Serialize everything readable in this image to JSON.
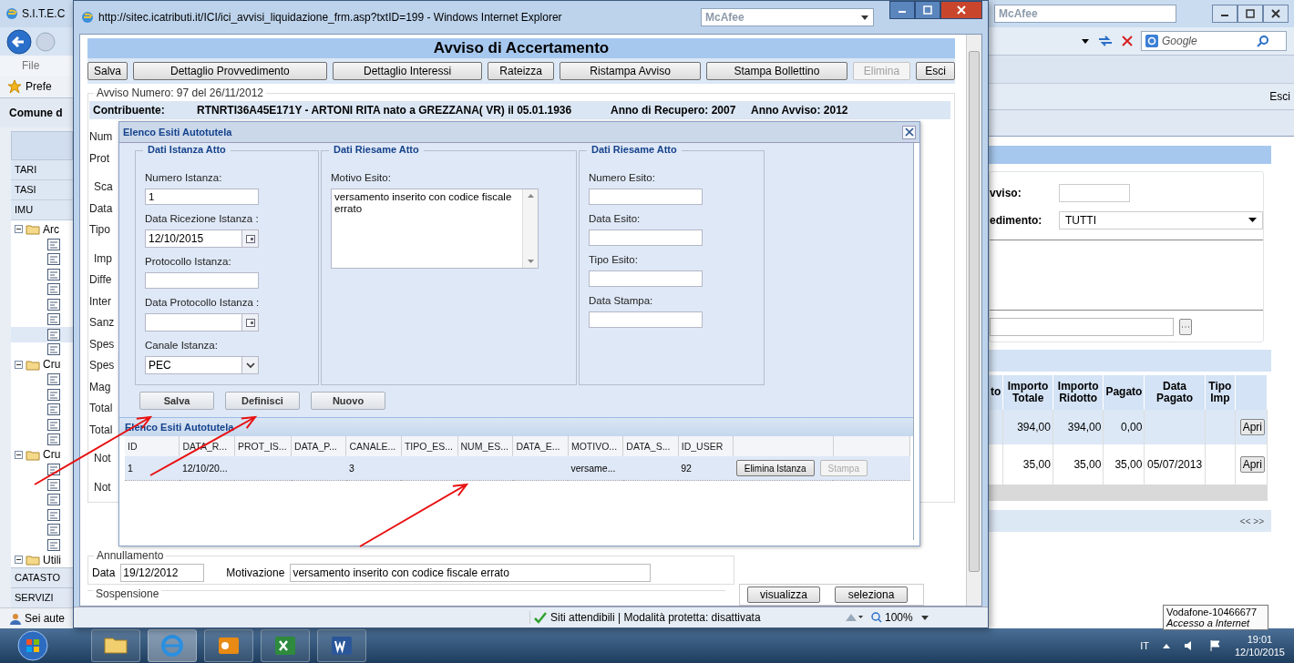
{
  "back_window": {
    "title": "S.I.T.E.C",
    "menu": [
      "File"
    ],
    "favorites": "Prefe",
    "header": "Comune d",
    "sidebar": [
      {
        "label": "TARI"
      },
      {
        "label": "TASI"
      },
      {
        "label": "IMU"
      }
    ],
    "tree": [
      {
        "label": "Arc",
        "expanded": true,
        "children": [
          {
            "kind": "leaf",
            "selected": false
          },
          {
            "kind": "leaf",
            "selected": false
          },
          {
            "kind": "leaf",
            "selected": false
          },
          {
            "kind": "leaf",
            "selected": false
          },
          {
            "kind": "leaf",
            "selected": false
          },
          {
            "kind": "leaf",
            "selected": false
          },
          {
            "kind": "leaf",
            "selected": true
          },
          {
            "kind": "leaf",
            "selected": false
          }
        ]
      },
      {
        "label": "Cru",
        "expanded": true,
        "children": [
          {
            "kind": "leaf",
            "selected": false
          },
          {
            "kind": "leaf",
            "selected": false
          },
          {
            "kind": "leaf",
            "selected": false
          },
          {
            "kind": "leaf",
            "selected": false
          },
          {
            "kind": "leaf",
            "selected": false
          }
        ]
      },
      {
        "label": "Cru",
        "expanded": true,
        "children": [
          {
            "kind": "leaf",
            "selected": false
          },
          {
            "kind": "leaf",
            "selected": false
          },
          {
            "kind": "leaf",
            "selected": false
          },
          {
            "kind": "leaf",
            "selected": false
          },
          {
            "kind": "leaf",
            "selected": false
          },
          {
            "kind": "leaf",
            "selected": false
          }
        ]
      },
      {
        "label": "Utili",
        "expanded": true
      }
    ],
    "footer_items": [
      {
        "label": "CATASTO"
      },
      {
        "label": "SERVIZI"
      }
    ],
    "status": "Sei aute",
    "addon": "McAfee",
    "search": {
      "placeholder": "Google"
    },
    "logout": "Esci",
    "form": [
      {
        "label": "vviso:",
        "kind": "text"
      },
      {
        "label": "edimento:",
        "kind": "select",
        "value": "TUTTI"
      }
    ],
    "table": {
      "columns": [
        "to",
        "Importo Totale",
        "Importo Ridotto",
        "Pagato",
        "Data Pagato",
        "Tipo Imp"
      ],
      "rows": [
        {
          "cells": [
            null,
            "394,00",
            "394,00",
            "0,00",
            null,
            null
          ],
          "action": "Apri"
        },
        {
          "cells": [
            null,
            "35,00",
            "35,00",
            "35,00",
            "05/07/2013",
            null
          ],
          "action": "Apri"
        }
      ]
    },
    "pager": "<< >>"
  },
  "front_window": {
    "title": "http://sitec.icatributi.it/ICI/ici_avvisi_liquidazione_frm.asp?txtID=199 - Windows Internet Explorer",
    "addon": "McAfee",
    "page_title": "Avviso di Accertamento",
    "toolbar": [
      {
        "label": "Salva",
        "disabled": false
      },
      {
        "label": "Dettaglio Provvedimento",
        "disabled": false
      },
      {
        "label": "Dettaglio Interessi",
        "disabled": false
      },
      {
        "label": "Rateizza",
        "disabled": false
      },
      {
        "label": "Ristampa Avviso",
        "disabled": false
      },
      {
        "label": "Stampa Bollettino",
        "disabled": false
      },
      {
        "label": "Elimina",
        "disabled": true
      },
      {
        "label": "Esci",
        "disabled": false
      }
    ],
    "avviso_legend": "Avviso Numero: 97 del 26/11/2012",
    "contribuente": {
      "label": "Contribuente:",
      "value": "RTNRTI36A45E171Y - ARTONI RITA nato a GREZZANA( VR) il 05.01.1936",
      "anno_recupero": "Anno di Recupero: 2007",
      "anno_avviso": "Anno Avviso: 2012"
    },
    "partial_labels": [
      {
        "label": "Num",
        "kind": "label"
      },
      {
        "label": "Prot",
        "kind": "label"
      },
      {
        "label": "Sca",
        "kind": "legend"
      },
      {
        "label": "Data",
        "kind": "label"
      },
      {
        "label": "Tipo",
        "kind": "label"
      },
      {
        "label": "Imp",
        "kind": "legend"
      },
      {
        "label": "Diffe",
        "kind": "label"
      },
      {
        "label": "Inter",
        "kind": "label"
      },
      {
        "label": "Sanz",
        "kind": "label"
      },
      {
        "label": "Spes",
        "kind": "label"
      },
      {
        "label": "Spes",
        "kind": "label"
      },
      {
        "label": "Mag",
        "kind": "label"
      },
      {
        "label": "Total",
        "kind": "label"
      },
      {
        "label": "Total",
        "kind": "label"
      },
      {
        "label": "Not",
        "kind": "legend"
      },
      {
        "label": "Not",
        "kind": "legend"
      }
    ],
    "side_buttons": [
      "visualizza",
      "seleziona"
    ],
    "annullamento": {
      "legend": "Annullamento",
      "data_label": "Data",
      "data_value": "19/12/2012",
      "motivazione_label": "Motivazione",
      "motivazione_value": "versamento inserito con codice fiscale errato"
    },
    "sospensione_legend": "Sospensione",
    "status_bar": {
      "zone": "Siti attendibili | Modalità protetta: disattivata",
      "zoom": "100%"
    }
  },
  "dialog": {
    "title": "Elenco Esiti Autotutela",
    "sections": [
      {
        "legend": "Dati Istanza Atto",
        "fields": [
          {
            "label": "Numero Istanza:",
            "kind": "text",
            "value": "1"
          },
          {
            "label": "Data Ricezione Istanza :",
            "kind": "date",
            "value": "12/10/2015"
          },
          {
            "label": "Protocollo Istanza:",
            "kind": "text"
          },
          {
            "label": "Data Protocollo Istanza :",
            "kind": "date"
          },
          {
            "label": "Canale Istanza:",
            "kind": "select",
            "value": "PEC"
          }
        ]
      },
      {
        "legend": "Dati Riesame Atto",
        "fields": [
          {
            "label": "Motivo Esito:",
            "kind": "textarea",
            "value": "versamento inserito con codice fiscale errato"
          }
        ]
      },
      {
        "legend": "Dati Riesame Atto",
        "fields": [
          {
            "label": "Numero Esito:",
            "kind": "text"
          },
          {
            "label": "Data Esito:",
            "kind": "text"
          },
          {
            "label": "Tipo Esito:",
            "kind": "text"
          },
          {
            "label": "Data Stampa:",
            "kind": "text"
          }
        ]
      }
    ],
    "buttons": [
      "Salva",
      "Definisci",
      "Nuovo"
    ],
    "grid": {
      "title": "Elenco Esiti Autotutela",
      "columns": [
        "ID",
        "DATA_R...",
        "PROT_IS...",
        "DATA_P...",
        "CANALE...",
        "TIPO_ES...",
        "NUM_ES...",
        "DATA_E...",
        "MOTIVO...",
        "DATA_S...",
        "ID_USER"
      ],
      "rows": [
        {
          "cells": [
            "1",
            "12/10/20...",
            null,
            null,
            "3",
            null,
            null,
            null,
            "versame...",
            null,
            "92"
          ],
          "actions": [
            {
              "label": "Elimina Istanza",
              "disabled": false
            },
            {
              "label": "Stampa",
              "disabled": true
            }
          ]
        }
      ]
    }
  },
  "tooltip": {
    "title": "Vodafone-10466677",
    "subtitle": "Accesso a Internet"
  },
  "taskbar": {
    "apps": [
      {
        "kind": "folder"
      },
      {
        "kind": "ie",
        "selected": true
      },
      {
        "kind": "outlook"
      },
      {
        "kind": "excel"
      },
      {
        "kind": "word"
      }
    ],
    "language": "IT",
    "time": "19:01",
    "date": "12/10/2015"
  }
}
